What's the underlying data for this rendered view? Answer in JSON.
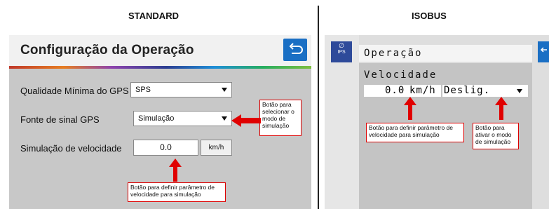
{
  "headers": {
    "standard": "STANDARD",
    "isobus": "ISOBUS"
  },
  "standard": {
    "title": "Configuração da Operação",
    "rows": {
      "gps_quality_label": "Qualidade Mínima do GPS",
      "gps_quality_value": "SPS",
      "gps_source_label": "Fonte de sinal GPS",
      "gps_source_value": "Simulação",
      "speed_label": "Simulação de velocidade",
      "speed_value": "0.0",
      "speed_unit": "km/h"
    },
    "callouts": {
      "mode": "Botão para selecionar o modo de simulação",
      "speed": "Botão para definir parâmetro de velocidade para simulação"
    }
  },
  "isobus": {
    "logo_text": "IPS",
    "title": "Operação",
    "speed_label": "Velocidade",
    "speed_value": "0.0",
    "speed_unit": "km/h",
    "mode_value": "Deslig.",
    "callouts": {
      "speed": "Botão para definir parâmetro de velocidade para simulação",
      "mode": "Botão para ativar o modo de simulação"
    }
  },
  "colors": {
    "accent_blue": "#1a6fc4",
    "callout_red": "#e00000",
    "stripe": [
      "#c0392b",
      "#e67e22",
      "#8e44ad",
      "#2c3e91",
      "#1f8fd8",
      "#27ae60",
      "#7fbf3f"
    ]
  }
}
